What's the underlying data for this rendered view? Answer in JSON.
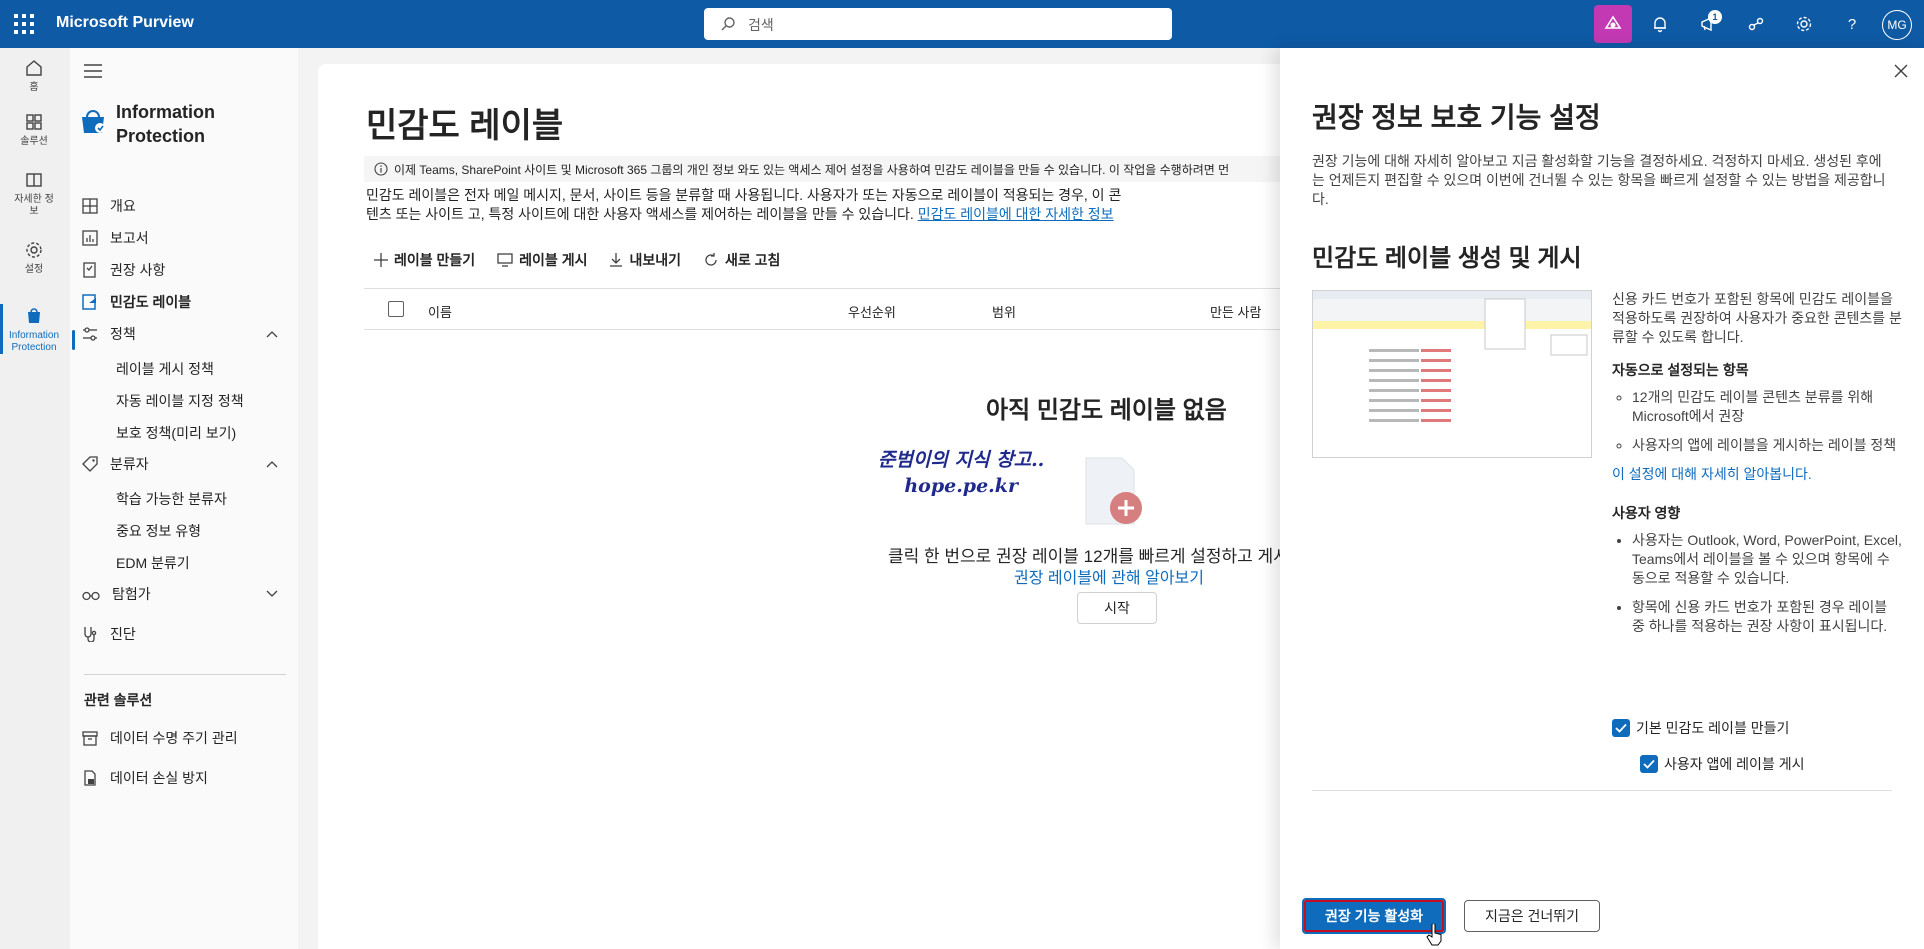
{
  "topbar": {
    "app_title": "Microsoft Purview",
    "search_placeholder": "검색",
    "notification_count": "1",
    "avatar_initials": "MG",
    "icons": [
      "waffle-icon",
      "search-icon",
      "copilot-icon",
      "bell-icon",
      "megaphone-icon",
      "connect-icon",
      "gear-icon",
      "help-icon"
    ]
  },
  "rail": {
    "items": [
      {
        "label": "홈",
        "icon": "home-icon"
      },
      {
        "label": "솔루션",
        "icon": "grid-icon"
      },
      {
        "label": "자세한 정보",
        "icon": "learn-icon"
      },
      {
        "label": "설정",
        "icon": "settings-icon"
      },
      {
        "label": "Information Protection",
        "icon": "info-protection-icon"
      }
    ]
  },
  "nav": {
    "title": "Information Protection",
    "items": [
      {
        "label": "개요",
        "icon": "overview-icon"
      },
      {
        "label": "보고서",
        "icon": "chart-icon"
      },
      {
        "label": "권장 사항",
        "icon": "recommendation-icon"
      },
      {
        "label": "민감도 레이블",
        "icon": "label-icon"
      },
      {
        "label": "정책",
        "icon": "sliders-icon"
      },
      {
        "label": "분류자",
        "icon": "tag-icon"
      },
      {
        "label": "탐험가",
        "icon": "explorer-icon"
      },
      {
        "label": "진단",
        "icon": "diagnose-icon"
      }
    ],
    "policy_sub": [
      "레이블 게시 정책",
      "자동 레이블 지정 정책",
      "보호 정책(미리 보기)"
    ],
    "classifier_sub": [
      "학습 가능한 분류자",
      "중요 정보 유형",
      "EDM 분류기"
    ],
    "related_heading": "관련 솔루션",
    "related": [
      {
        "label": "데이터 수명 주기 관리",
        "icon": "archive-icon"
      },
      {
        "label": "데이터 손실 방지",
        "icon": "dlp-icon"
      }
    ]
  },
  "main": {
    "title": "민감도 레이블",
    "info_bar": "이제 Teams, SharePoint 사이트 및 Microsoft 365 그룹의 개인 정보 와도 있는 액세스 제어 설정을 사용하여 민감도 레이블을 만들 수 있습니다. 이 작업을 수행하려면 먼",
    "desc": "민감도 레이블은 전자 메일 메시지, 문서, 사이트 등을 분류할 때 사용됩니다. 사용자가 또는 자동으로 레이블이 적용되는 경우, 이 콘텐츠 또는 사이트 고, 특정 사이트에 대한 사용자 액세스를 제어하는 레이블을 만들 수 있습니다. ",
    "desc_link": "민감도 레이블에 대한 자세한 정보",
    "commands": [
      {
        "label": "레이블 만들기",
        "icon": "plus-icon"
      },
      {
        "label": "레이블 게시",
        "icon": "publish-icon"
      },
      {
        "label": "내보내기",
        "icon": "download-icon"
      },
      {
        "label": "새로 고침",
        "icon": "refresh-icon"
      }
    ],
    "columns": [
      "이름",
      "우선순위",
      "범위",
      "만든 사람"
    ],
    "empty_title": "아직 민감도 레이블 없음",
    "watermark_line1": "준범이의 지식 창고..",
    "watermark_line2": "hope.pe.kr",
    "empty_text": "클릭 한 번으로 권장 레이블 12개를 빠르게 설정하고 게시",
    "empty_link": "권장 레이블에 관해 알아보기",
    "start_button": "시작"
  },
  "panel": {
    "title": "권장 정보 보호 기능 설정",
    "desc": "권장 기능에 대해 자세히 알아보고 지금 활성화할 기능을 결정하세요. 걱정하지 마세요. 생성된 후에는 언제든지 편집할 수 있으며 이번에 건너뛸 수 있는 항목을 빠르게 설정할 수 있는 방법을 제공합니다.",
    "section_title": "민감도 레이블 생성 및 게시",
    "section_desc": "신용 카드 번호가 포함된 항목에 민감도 레이블을 적용하도록 권장하여 사용자가 중요한 콘텐츠를 분류할 수 있도록 합니다.",
    "auto_heading": "자동으로 설정되는 항목",
    "auto_items": [
      "12개의 민감도 레이블 콘텐츠 분류를 위해 Microsoft에서 권장",
      "사용자의 앱에 레이블을 게시하는 레이블 정책"
    ],
    "learn_link": "이 설정에 대해 자세히 알아봅니다.",
    "impact_heading": "사용자 영향",
    "impact_items": [
      "사용자는 Outlook, Word, PowerPoint, Excel, Teams에서 레이블을 볼 수 있으며 항목에 수동으로 적용할 수 있습니다.",
      "항목에 신용 카드 번호가 포함된 경우 레이블 중 하나를 적용하는 권장 사항이 표시됩니다."
    ],
    "checkbox1": "기본 민감도 레이블 만들기",
    "checkbox2": "사용자 앱에 레이블 게시",
    "checkbox1_checked": true,
    "checkbox2_checked": true,
    "primary_button": "권장 기능 활성화",
    "secondary_button": "지금은 건너뛰기"
  },
  "colors": {
    "topbar": "#0f5aa5",
    "accent": "#0f6cbd",
    "copilot": "#c239b3",
    "highlight_border": "#c50f1f"
  }
}
